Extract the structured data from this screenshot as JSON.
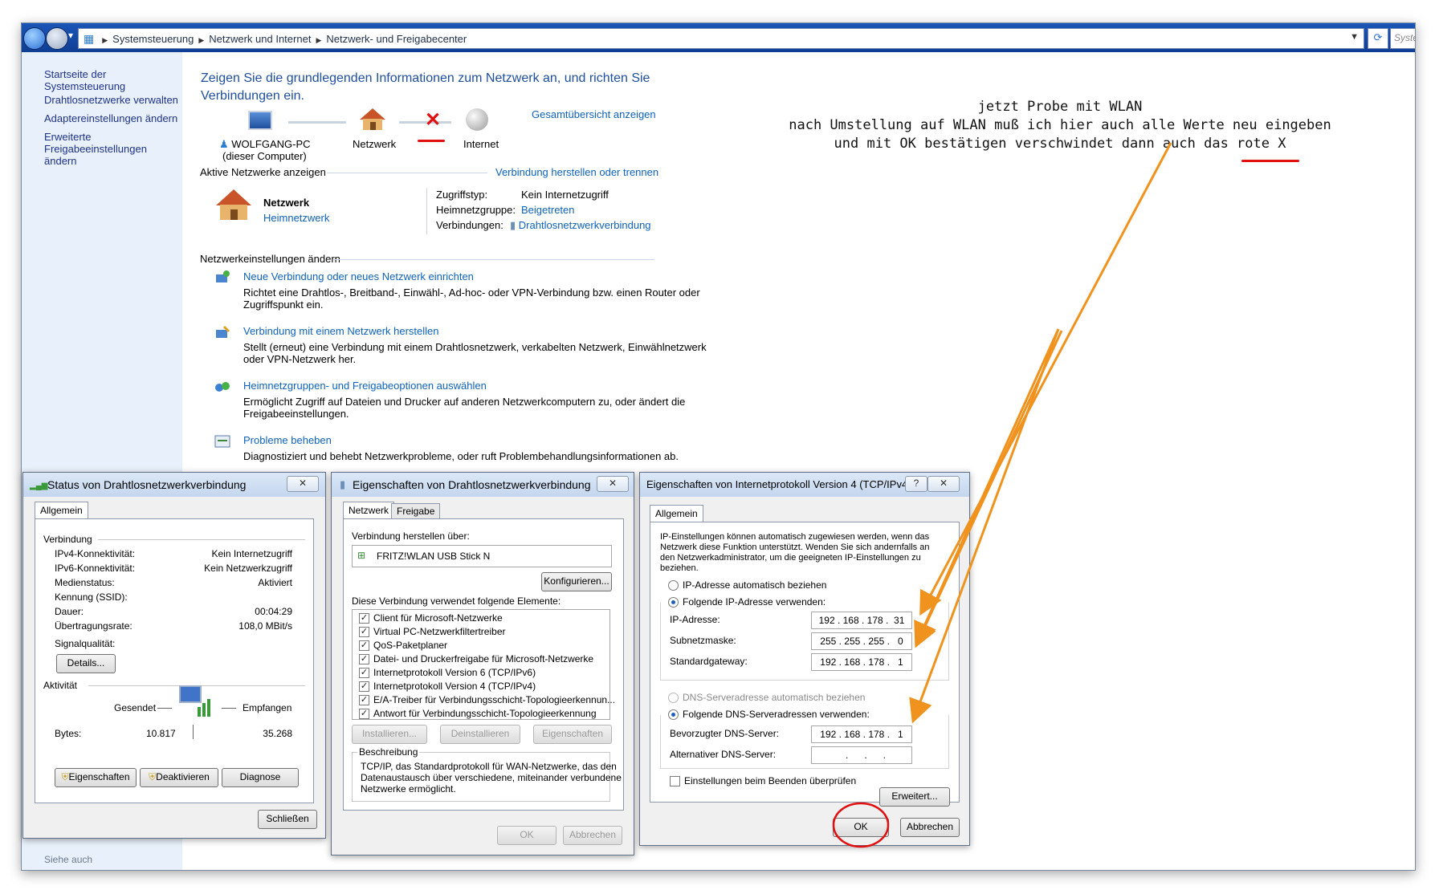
{
  "breadcrumb": {
    "items": [
      "Systemsteuerung",
      "Netzwerk und Internet",
      "Netzwerk- und Freigabecenter"
    ],
    "search_placeholder": "Systemsteuerung durchsuchen"
  },
  "sidebar": {
    "items": [
      "Startseite der Systemsteuerung",
      "Drahtlosnetzwerke verwalten",
      "Adaptereinstellungen ändern",
      "Erweiterte Freigabeeinstellungen ändern"
    ],
    "see_also": "Siehe auch"
  },
  "main": {
    "headline": "Zeigen Sie die grundlegenden Informationen zum Netzwerk an, und richten Sie Verbindungen ein.",
    "map": {
      "pc_name": "WOLFGANG-PC",
      "pc_sub": "(dieser Computer)",
      "network": "Netzwerk",
      "internet": "Internet",
      "overview_link": "Gesamtübersicht anzeigen"
    },
    "active": {
      "section_label": "Aktive Netzwerke anzeigen",
      "connect_link": "Verbindung herstellen oder trennen",
      "name": "Netzwerk",
      "type": "Heimnetzwerk",
      "access_label": "Zugriffstyp:",
      "access_value": "Kein Internetzugriff",
      "homegroup_label": "Heimnetzgruppe:",
      "homegroup_value": "Beigetreten",
      "connections_label": "Verbindungen:",
      "connections_value": "Drahtlosnetzwerkverbindung"
    },
    "settings": {
      "section_label": "Netzwerkeinstellungen ändern",
      "tasks": [
        {
          "title": "Neue Verbindung oder neues Netzwerk einrichten",
          "desc1": "Richtet eine Drahtlos-, Breitband-, Einwähl-, Ad-hoc- oder VPN-Verbindung bzw. einen Router oder",
          "desc2": "Zugriffspunkt ein."
        },
        {
          "title": "Verbindung mit einem Netzwerk herstellen",
          "desc1": "Stellt (erneut) eine Verbindung mit einem Drahtlosnetzwerk, verkabelten Netzwerk, Einwählnetzwerk",
          "desc2": "oder VPN-Netzwerk her."
        },
        {
          "title": "Heimnetzgruppen- und Freigabeoptionen auswählen",
          "desc1": "Ermöglicht Zugriff auf Dateien und Drucker auf anderen Netzwerkcomputern zu, oder ändert die",
          "desc2": "Freigabeeinstellungen."
        },
        {
          "title": "Probleme beheben",
          "desc1": "Diagnostiziert und behebt Netzwerkprobleme, oder ruft Problembehandlungsinformationen ab.",
          "desc2": ""
        }
      ]
    }
  },
  "status_dialog": {
    "title": "Status von Drahtlosnetzwerkverbindung",
    "tab": "Allgemein",
    "connection_group": "Verbindung",
    "rows": [
      {
        "label": "IPv4-Konnektivität:",
        "value": "Kein Internetzugriff"
      },
      {
        "label": "IPv6-Konnektivität:",
        "value": "Kein Netzwerkzugriff"
      },
      {
        "label": "Medienstatus:",
        "value": "Aktiviert"
      },
      {
        "label": "Kennung (SSID):",
        "value": ""
      },
      {
        "label": "Dauer:",
        "value": "00:04:29"
      },
      {
        "label": "Übertragungsrate:",
        "value": "108,0 MBit/s"
      }
    ],
    "signal_label": "Signalqualität:",
    "details_button": "Details...",
    "activity_group": "Aktivität",
    "sent_label": "Gesendet",
    "received_label": "Empfangen",
    "bytes_label": "Bytes:",
    "bytes_sent": "10.817",
    "bytes_received": "35.268",
    "buttons": {
      "properties": "Eigenschaften",
      "deactivate": "Deaktivieren",
      "diagnose": "Diagnose"
    },
    "close_button": "Schließen"
  },
  "props_dialog": {
    "title": "Eigenschaften von Drahtlosnetzwerkverbindung",
    "tabs": [
      "Netzwerk",
      "Freigabe"
    ],
    "connect_via_label": "Verbindung herstellen über:",
    "adapter": "FRITZ!WLAN USB Stick N",
    "configure_button": "Konfigurieren...",
    "items_label": "Diese Verbindung verwendet folgende Elemente:",
    "items": [
      "Client für Microsoft-Netzwerke",
      "Virtual PC-Netzwerkfiltertreiber",
      "QoS-Paketplaner",
      "Datei- und Druckerfreigabe für Microsoft-Netzwerke",
      "Internetprotokoll Version 6 (TCP/IPv6)",
      "Internetprotokoll Version 4 (TCP/IPv4)",
      "E/A-Treiber für Verbindungsschicht-Topologieerkennun...",
      "Antwort für Verbindungsschicht-Topologieerkennung"
    ],
    "buttons": {
      "install": "Installieren...",
      "uninstall": "Deinstallieren",
      "properties": "Eigenschaften"
    },
    "description_label": "Beschreibung",
    "description_lines": [
      "TCP/IP, das Standardprotokoll für WAN-Netzwerke, das den",
      "Datenaustausch über verschiedene, miteinander verbundene",
      "Netzwerke ermöglicht."
    ],
    "ok": "OK",
    "cancel": "Abbrechen"
  },
  "ipv4_dialog": {
    "title": "Eigenschaften von Internetprotokoll Version 4 (TCP/IPv4)",
    "help": "?",
    "tab": "Allgemein",
    "info_lines": [
      "IP-Einstellungen können automatisch zugewiesen werden, wenn das",
      "Netzwerk diese Funktion unterstützt. Wenden Sie sich andernfalls an",
      "den Netzwerkadministrator, um die geeigneten IP-Einstellungen zu",
      "beziehen."
    ],
    "auto_ip": "IP-Adresse automatisch beziehen",
    "manual_ip": "Folgende IP-Adresse verwenden:",
    "ip_label": "IP-Adresse:",
    "ip_value": "192 . 168 . 178 .  31",
    "mask_label": "Subnetzmaske:",
    "mask_value": "255 . 255 . 255 .   0",
    "gateway_label": "Standardgateway:",
    "gateway_value": "192 . 168 . 178 .   1",
    "auto_dns": "DNS-Serveradresse automatisch beziehen",
    "manual_dns": "Folgende DNS-Serveradressen verwenden:",
    "dns1_label": "Bevorzugter DNS-Server:",
    "dns1_value": "192 . 168 . 178 .   1",
    "dns2_label": "Alternativer DNS-Server:",
    "dns2_value": "   .      .      .",
    "validate_label": "Einstellungen beim Beenden überprüfen",
    "advanced_button": "Erweitert...",
    "ok": "OK",
    "cancel": "Abbrechen"
  },
  "annotation": {
    "line1": "jetzt Probe mit WLAN",
    "line2": "nach Umstellung auf WLAN muß ich hier auch alle Werte neu eingeben",
    "line3": "und mit OK bestätigen verschwindet dann auch das rote X"
  },
  "colors": {
    "link": "#0e62b9",
    "accent_orange": "#f0921e",
    "mark_red": "#e01010"
  }
}
